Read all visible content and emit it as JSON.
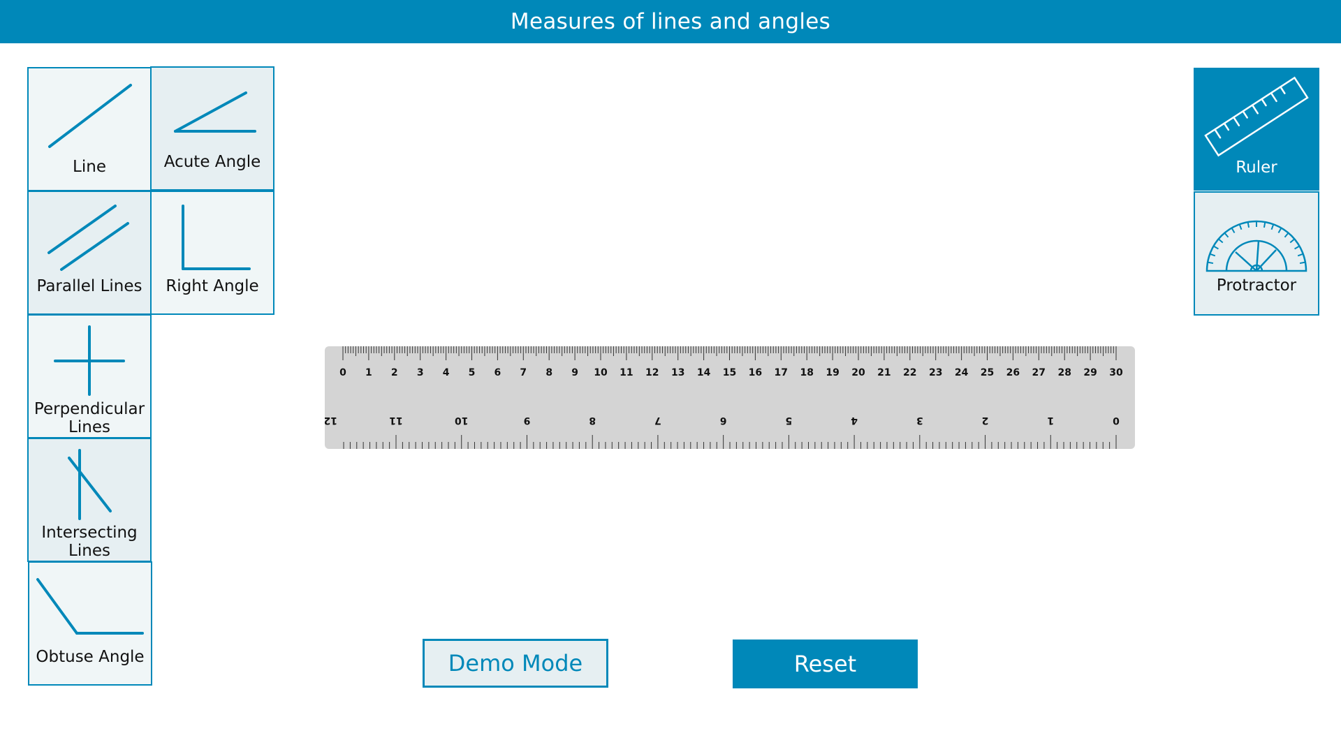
{
  "header": {
    "title": "Measures of lines and angles"
  },
  "shapes": [
    {
      "id": "line",
      "label": "Line",
      "icon": "line-icon"
    },
    {
      "id": "acute-angle",
      "label": "Acute Angle",
      "icon": "acute-angle-icon"
    },
    {
      "id": "parallel-lines",
      "label": "Parallel Lines",
      "icon": "parallel-lines-icon"
    },
    {
      "id": "right-angle",
      "label": "Right Angle",
      "icon": "right-angle-icon"
    },
    {
      "id": "perpendicular-lines",
      "label_line1": "Perpendicular",
      "label_line2": "Lines",
      "icon": "perpendicular-lines-icon"
    },
    {
      "id": "intersecting-lines",
      "label_line1": "Intersecting",
      "label_line2": "Lines",
      "icon": "intersecting-lines-icon"
    },
    {
      "id": "obtuse-angle",
      "label": "Obtuse Angle",
      "icon": "obtuse-angle-icon"
    }
  ],
  "tools": [
    {
      "id": "ruler",
      "label": "Ruler",
      "icon": "ruler-icon",
      "active": true
    },
    {
      "id": "protractor",
      "label": "Protractor",
      "icon": "protractor-icon",
      "active": false
    }
  ],
  "ruler": {
    "cm_labels": [
      "0",
      "1",
      "2",
      "3",
      "4",
      "5",
      "6",
      "7",
      "8",
      "9",
      "10",
      "11",
      "12",
      "13",
      "14",
      "15",
      "16",
      "17",
      "18",
      "19",
      "20",
      "21",
      "22",
      "23",
      "24",
      "25",
      "26",
      "27",
      "28",
      "29",
      "30"
    ],
    "inch_labels": [
      "12",
      "11",
      "10",
      "9",
      "8",
      "7",
      "6",
      "5",
      "4",
      "3",
      "2",
      "1",
      "0"
    ]
  },
  "buttons": {
    "demo_mode": "Demo Mode",
    "reset": "Reset"
  },
  "colors": {
    "accent": "#0088b9",
    "tile_bg": "#f0f6f7",
    "ruler_bg": "#d4d4d4"
  }
}
